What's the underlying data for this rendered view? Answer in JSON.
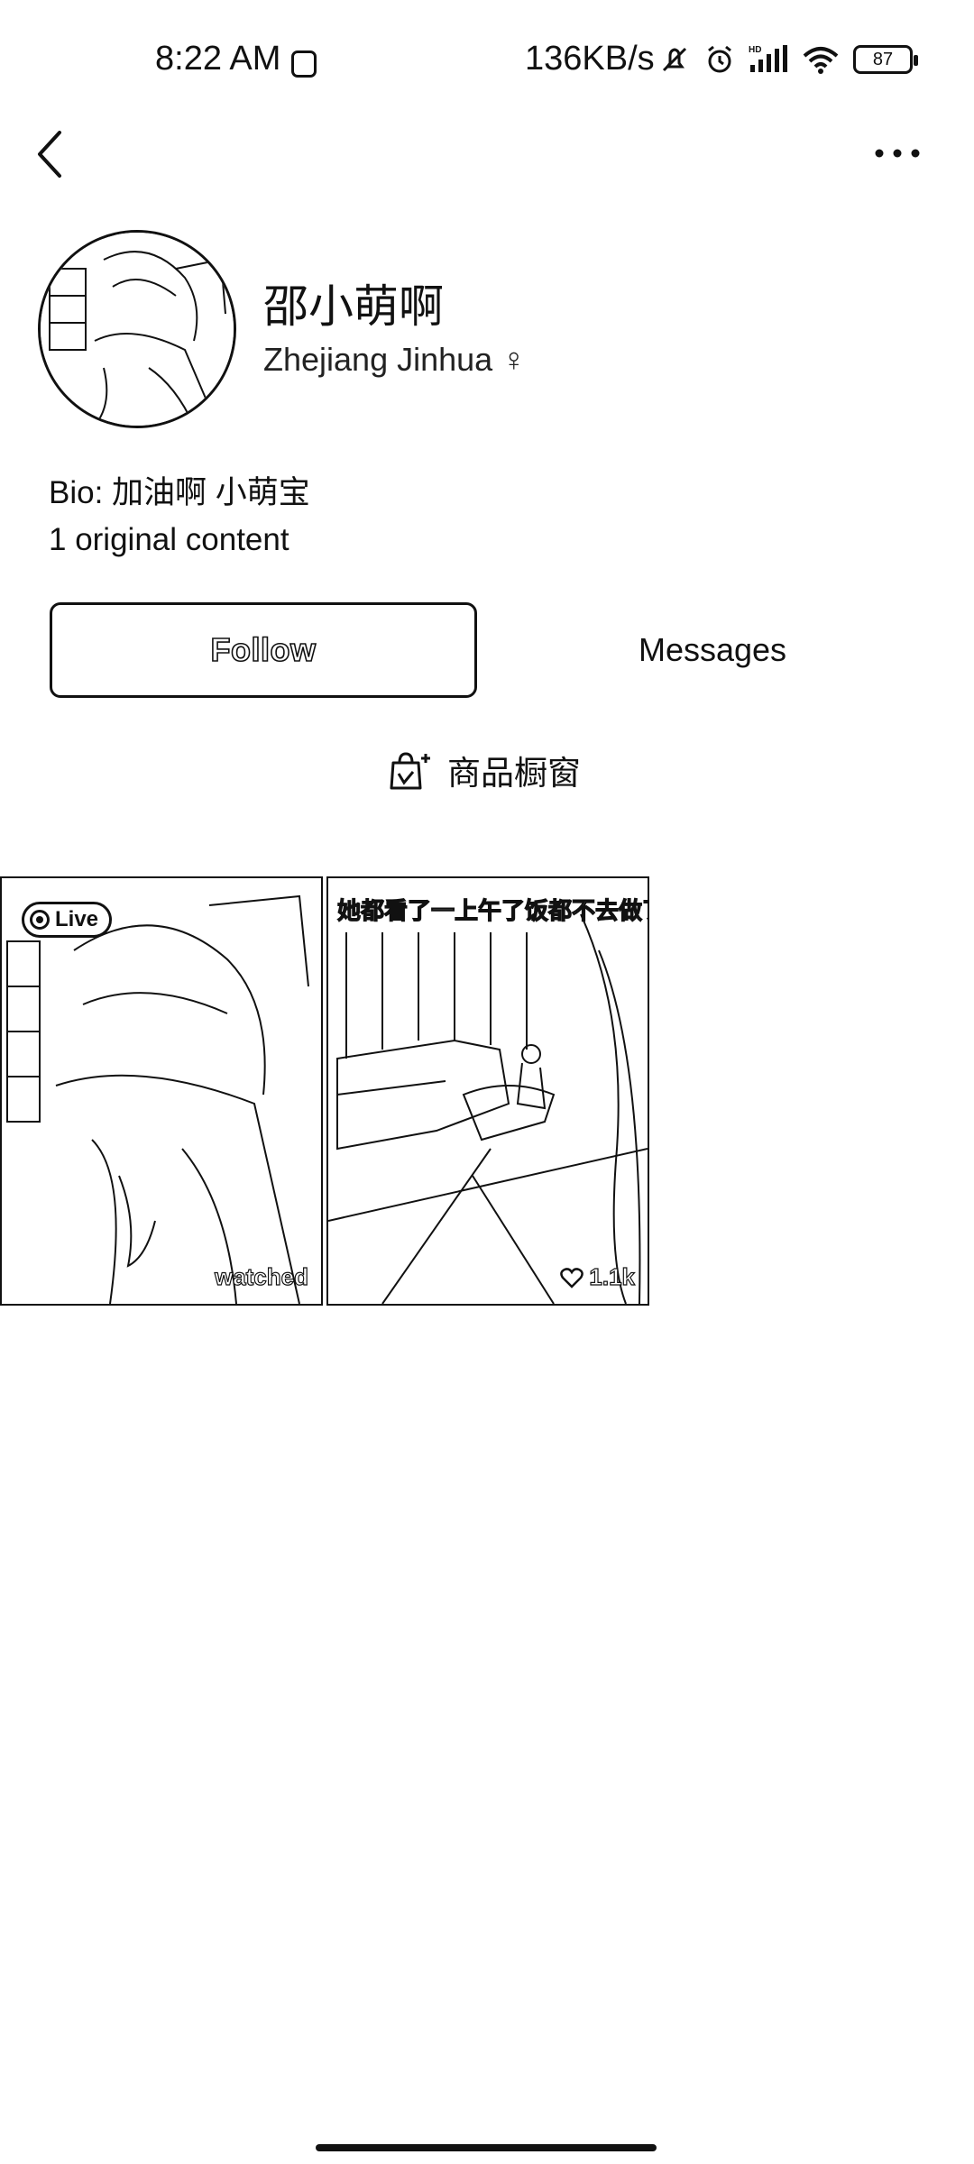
{
  "status_bar": {
    "time": "8:22 AM",
    "network_speed": "136KB/s",
    "battery": "87"
  },
  "profile": {
    "name": "邵小萌啊",
    "location": "Zhejiang Jinhua ♀",
    "bio": "Bio: 加油啊 小萌宝",
    "original_content": "1 original content"
  },
  "actions": {
    "follow_label": "Follow",
    "messages_label": "Messages",
    "shop_window_label": "商品橱窗"
  },
  "posts": [
    {
      "badge": "Live",
      "overlay_text": "watched"
    },
    {
      "caption": "她都看了一上午了饭都不去做了",
      "likes": "1.1k"
    }
  ],
  "colors": {
    "foreground": "#111111",
    "background": "#ffffff"
  },
  "icons": {
    "back": "chevron-left-icon",
    "more": "more-horizontal-icon",
    "shop": "shopping-bag-icon",
    "heart": "heart-icon"
  }
}
